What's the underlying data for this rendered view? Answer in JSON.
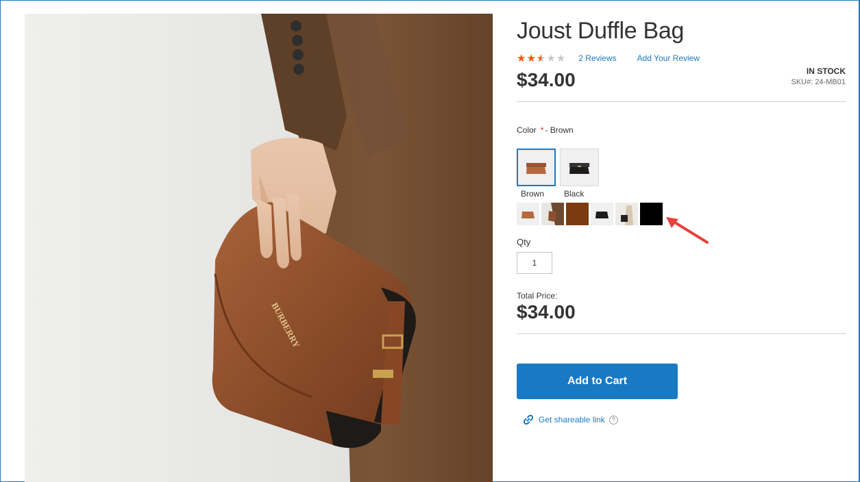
{
  "product": {
    "title": "Joust Duffle Bag",
    "rating_fraction": 0.5,
    "reviews_label": "2 Reviews",
    "add_review_label": "Add Your Review",
    "price": "$34.00",
    "stock": "IN STOCK",
    "sku_label": "SKU#:",
    "sku": "24-MB01",
    "brand_on_bag": "BURBERRY"
  },
  "options": {
    "color_label": "Color",
    "required_mark": "*",
    "selected_color": "- Brown",
    "swatches": [
      {
        "label": "Brown",
        "color": "#b5693f"
      },
      {
        "label": "Black",
        "color": "#1c1c1c"
      }
    ]
  },
  "gallery_thumbs": [
    {
      "name": "brown-bag-thumb"
    },
    {
      "name": "brown-model-thumb"
    },
    {
      "name": "brown-fill-thumb",
      "color": "#7b3a0f"
    },
    {
      "name": "black-bag-thumb"
    },
    {
      "name": "black-model-thumb"
    },
    {
      "name": "black-fill-thumb",
      "color": "#000000"
    }
  ],
  "qty": {
    "label": "Qty",
    "value": "1"
  },
  "total": {
    "label": "Total Price:",
    "value": "$34.00"
  },
  "actions": {
    "add_to_cart": "Add to Cart",
    "share": "Get shareable link",
    "help_glyph": "?"
  },
  "colors": {
    "accent": "#1979c3",
    "star": "#ff5501",
    "annotation_arrow": "#e8403a"
  }
}
